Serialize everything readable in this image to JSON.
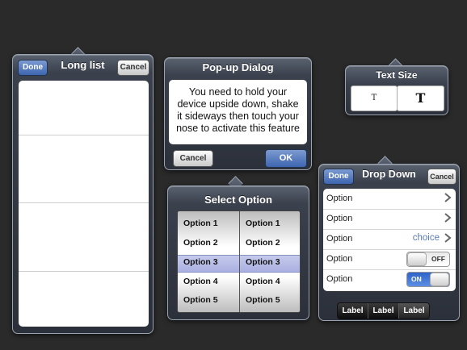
{
  "long_list": {
    "title": "Long list",
    "done_label": "Done",
    "cancel_label": "Cancel"
  },
  "popup_dialog": {
    "title": "Pop-up Dialog",
    "message": "You need to hold your device upside down, shake it sideways then touch your nose to activate this feature",
    "cancel_label": "Cancel",
    "ok_label": "OK"
  },
  "select_option": {
    "title": "Select Option",
    "left_column": [
      "Option 1",
      "Option 2",
      "Option 3",
      "Option 4",
      "Option 5"
    ],
    "right_column": [
      "Option 1",
      "Option 2",
      "Option 3",
      "Option 4",
      "Option 5"
    ],
    "selected": "Option 3"
  },
  "text_size": {
    "title": "Text Size",
    "small_label": "T",
    "large_label": "T"
  },
  "drop_down": {
    "title": "Drop Down",
    "done_label": "Done",
    "cancel_label": "Cancel",
    "rows": [
      {
        "label": "Option"
      },
      {
        "label": "Option"
      },
      {
        "label": "Option",
        "value": "choice"
      },
      {
        "label": "Option",
        "switch": "OFF"
      },
      {
        "label": "Option",
        "switch": "ON"
      }
    ],
    "segments": [
      "Label",
      "Label",
      "Label"
    ]
  },
  "colors": {
    "background": "#2a2a2a",
    "accent_blue": "#3d65b0",
    "choice_text": "#5a7bb8"
  }
}
